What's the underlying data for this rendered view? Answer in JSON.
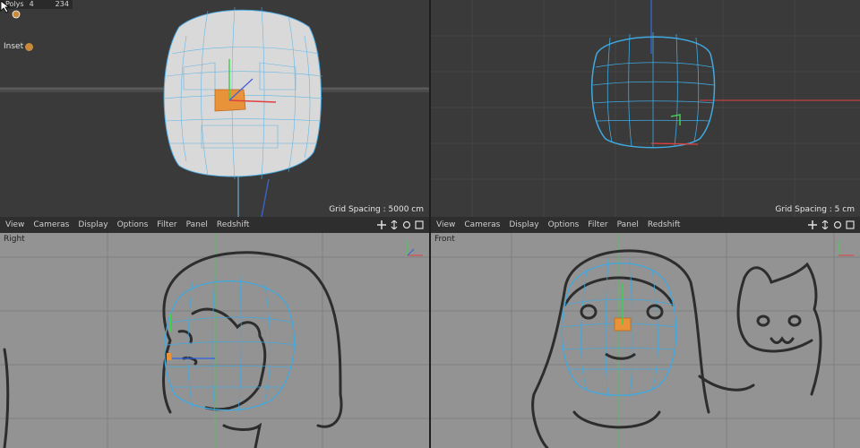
{
  "top_left": {
    "polys_label": "Polys",
    "polys_value": "4",
    "polys_count": "234",
    "tool_label": "Inset",
    "grid_spacing": "Grid Spacing : 5000 cm"
  },
  "top_right": {
    "grid_spacing": "Grid Spacing : 5 cm"
  },
  "menu": [
    "View",
    "Cameras",
    "Display",
    "Options",
    "Filter",
    "Panel",
    "Redshift"
  ],
  "bottom_left": {
    "label": "Right"
  },
  "bottom_right": {
    "label": "Front"
  },
  "icons": {
    "nav": [
      "move-icon",
      "pan-icon",
      "rotate-icon",
      "maximize-icon"
    ],
    "tool": "inset-tool-icon"
  },
  "colors": {
    "mesh_wire": "#3fa9e0",
    "selection": "#e8933a",
    "axis_x": "#e04040",
    "axis_y": "#3fd04f",
    "sketch": "#2d2d2d"
  }
}
